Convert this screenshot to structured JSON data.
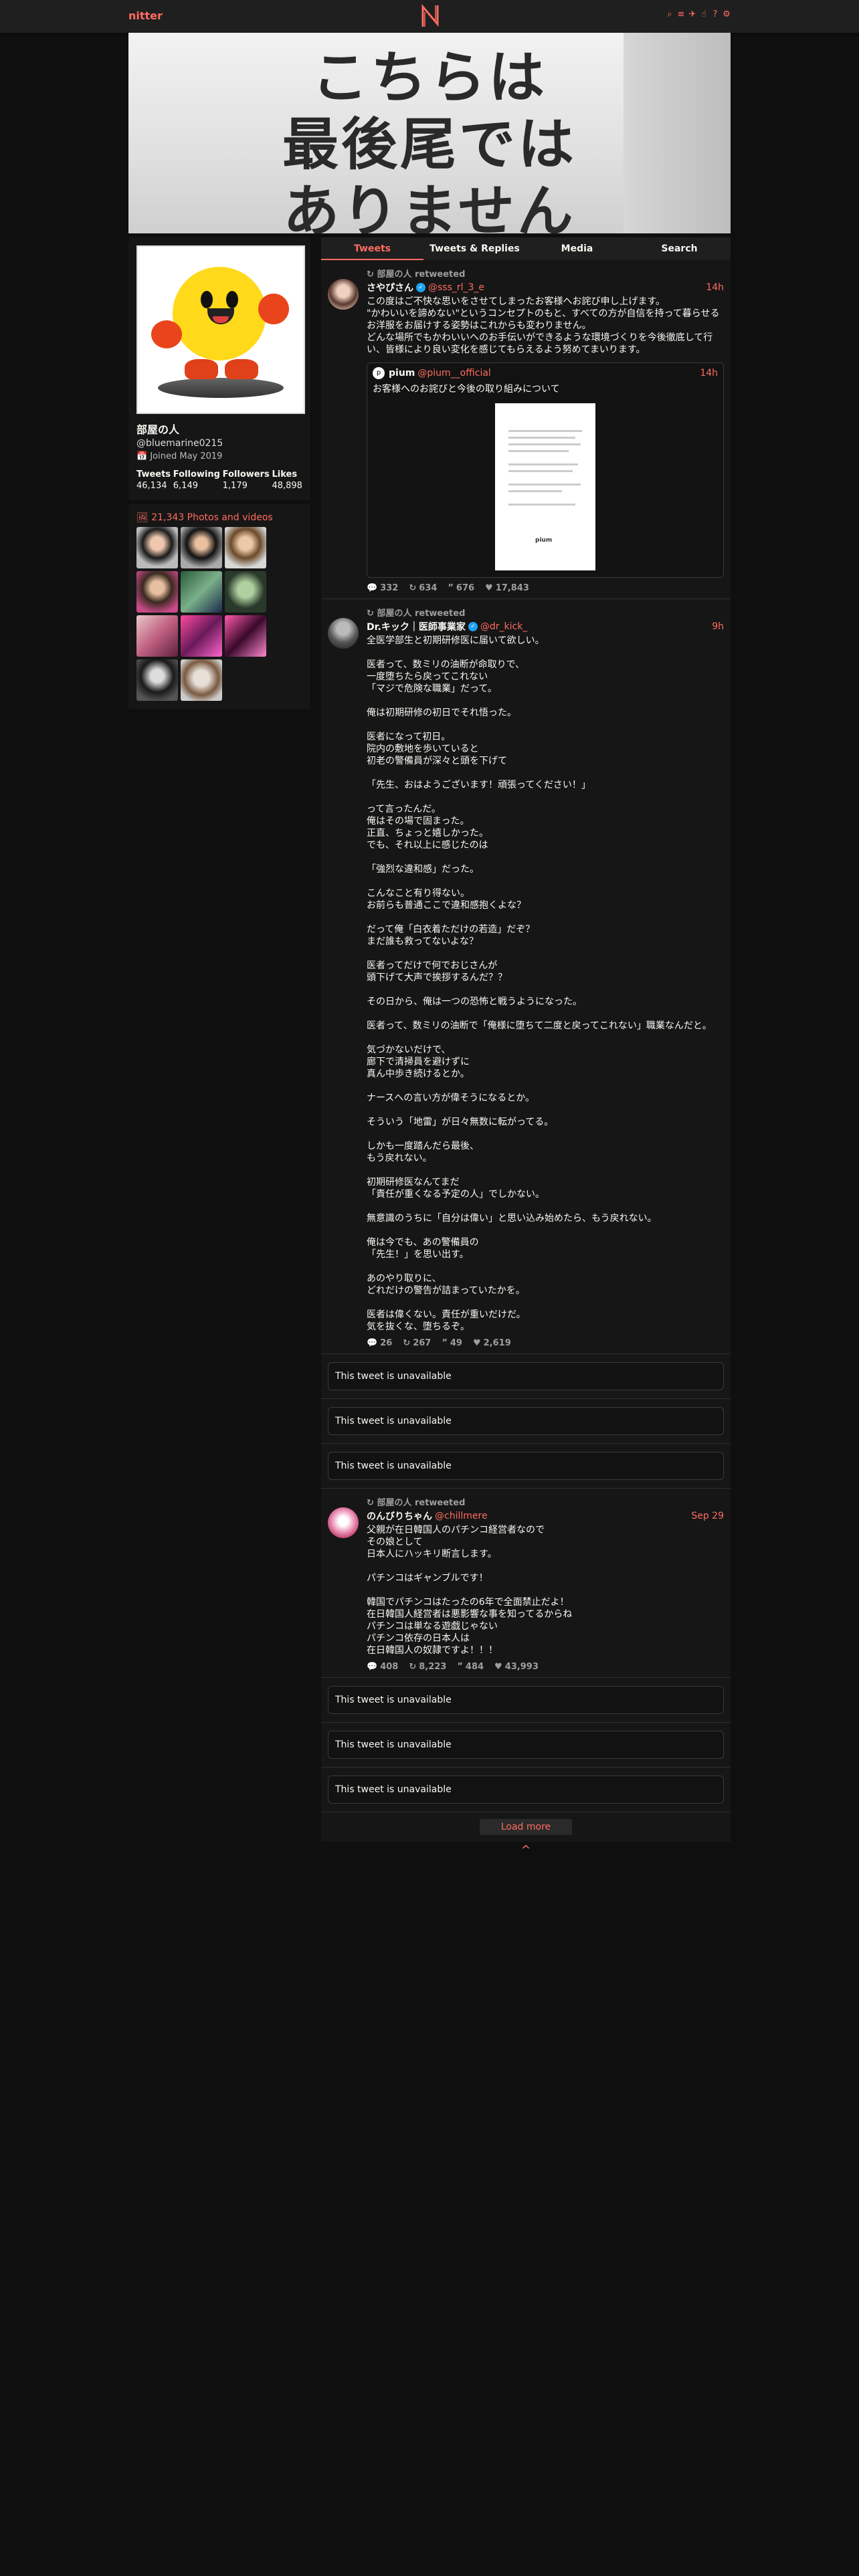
{
  "nav": {
    "brand": "nitter",
    "icons": [
      "search-icon",
      "rss-icon",
      "twitter-icon",
      "thumbs-up-icon",
      "question-icon",
      "gear-icon"
    ]
  },
  "banner": {
    "lines": [
      "こちらは",
      "最後尾では",
      "ありません"
    ]
  },
  "profile": {
    "fullname": "部屋の人",
    "username": "@bluemarine0215",
    "joined": "Joined May 2019",
    "stats": [
      {
        "label": "Tweets",
        "value": "46,134"
      },
      {
        "label": "Following",
        "value": "6,149"
      },
      {
        "label": "Followers",
        "value": "1,179"
      },
      {
        "label": "Likes",
        "value": "48,898"
      }
    ]
  },
  "photos": {
    "title": "21,343 Photos and videos"
  },
  "tabs": [
    {
      "label": "Tweets",
      "active": true
    },
    {
      "label": "Tweets & Replies"
    },
    {
      "label": "Media"
    },
    {
      "label": "Search"
    }
  ],
  "tweets": [
    {
      "retweet": "部屋の人 retweeted",
      "name": "さやぴさん",
      "handle": "@sss_rl_3_e",
      "verified": true,
      "date": "14h",
      "content": "この度はご不快な思いをさせてしまったお客様へお詫び申し上げます。\n\"かわいいを諦めない\"というコンセプトのもと、すべての方が自信を持って暮らせるお洋服をお届けする姿勢はこれからも変わりません。\nどんな場所でもかわいいへのお手伝いができるような環境づくりを今後徹底して行い、皆様により良い変化を感じてもらえるよう努めてまいります。",
      "quote": {
        "name": "pium",
        "handle": "@pium__official",
        "date": "14h",
        "text": "お客様へのお詫びと今後の取り組みについて",
        "img_sig": "pium"
      },
      "stats": {
        "replies": "332",
        "retweets": "634",
        "quotes": "676",
        "likes": "17,843"
      }
    },
    {
      "retweet": "部屋の人 retweeted",
      "name": "Dr.キック｜医師事業家",
      "handle": "@dr_kick_",
      "verified": true,
      "date": "9h",
      "content": "全医学部生と初期研修医に届いて欲しい。\n\n医者って、数ミリの油断が命取りで、\n一度堕ちたら戻ってこれない\n「マジで危険な職業」だって。\n\n俺は初期研修の初日でそれ悟った。\n\n医者になって初日。\n院内の敷地を歩いていると\n初老の警備員が深々と頭を下げて\n\n「先生、おはようございます！頑張ってください！」\n\nって言ったんだ。\n俺はその場で固まった。\n正直、ちょっと嬉しかった。\nでも、それ以上に感じたのは\n\n「強烈な違和感」だった。\n\nこんなこと有り得ない。\nお前らも普通ここで違和感抱くよな？\n\nだって俺「白衣着ただけの若造」だぞ？\nまだ誰も救ってないよな？\n\n医者ってだけで何でおじさんが\n頭下げて大声で挨拶するんだ？？\n\nその日から、俺は一つの恐怖と戦うようになった。\n\n医者って、数ミリの油断で「俺様に堕ちて二度と戻ってこれない」職業なんだと。\n\n気づかないだけで、\n廊下で清掃員を避けずに\n真ん中歩き続けるとか。\n\nナースへの言い方が偉そうになるとか。\n\nそういう「地雷」が日々無数に転がってる。\n\nしかも一度踏んだら最後、\nもう戻れない。\n\n初期研修医なんてまだ\n「責任が重くなる予定の人」でしかない。\n\n無意識のうちに「自分は偉い」と思い込み始めたら、もう戻れない。\n\n俺は今でも、あの警備員の\n「先生！」を思い出す。\n\nあのやり取りに、\nどれだけの警告が詰まっていたかを。\n\n医者は偉くない。責任が重いだけだ。\n気を抜くな、堕ちるぞ。",
      "stats": {
        "replies": "26",
        "retweets": "267",
        "quotes": "49",
        "likes": "2,619"
      }
    },
    {
      "retweet": "部屋の人 retweeted",
      "name": "のんびりちゃん",
      "handle": "@chillmere",
      "verified": false,
      "date": "Sep 29",
      "content": "父親が在日韓国人のパチンコ経営者なので\nその娘として\n日本人にハッキリ断言します。\n\nパチンコはギャンブルです！\n\n韓国でパチンコはたったの6年で全面禁止だよ！\n在日韓国人経営者は悪影響な事を知ってるからね\nパチンコは単なる遊戯じゃない\nパチンコ依存の日本人は\n在日韓国人の奴隷ですよ！！！",
      "stats": {
        "replies": "408",
        "retweets": "8,223",
        "quotes": "484",
        "likes": "43,993"
      }
    }
  ],
  "unavailable": "This tweet is unavailable",
  "load_more": "Load more",
  "back_to_top": "^"
}
